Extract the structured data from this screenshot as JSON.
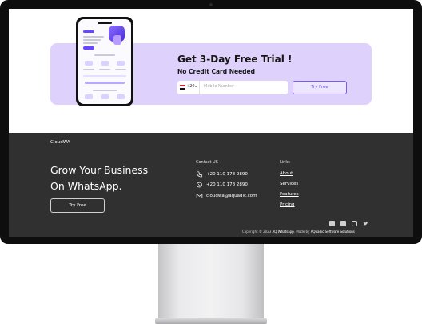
{
  "trial": {
    "title": "Get 3-Day Free Trial !",
    "subtitle": "No Credit Card Needed",
    "country_code": "+20",
    "phone_placeholder": "Mobile Number",
    "button_label": "Try Free"
  },
  "footer": {
    "brand": "CloudWA",
    "headline_line1": "Grow Your Business",
    "headline_line2": "On WhatsApp.",
    "button_label": "Try Free",
    "contact": {
      "title": "Contact US",
      "phone": "+20 110 178 2890",
      "whatsapp": "+20 110 178 2890",
      "email": "cloudwa@aquadic.com"
    },
    "links": {
      "title": "Links",
      "items": [
        "About",
        "Services",
        "Features",
        "Pricing"
      ]
    },
    "social_icons": [
      "facebook-icon",
      "linkedin-icon",
      "instagram-icon",
      "twitter-icon"
    ],
    "copyright": {
      "prefix": "Copyright © 2023",
      "brand_link": "AQ Whatsapp",
      "middle": ". Made by",
      "maker_link": "AQuadic Software Solutions"
    }
  },
  "colors": {
    "accent": "#6b46f0",
    "card_bg": "#ded1fb",
    "footer_bg": "#303030"
  }
}
